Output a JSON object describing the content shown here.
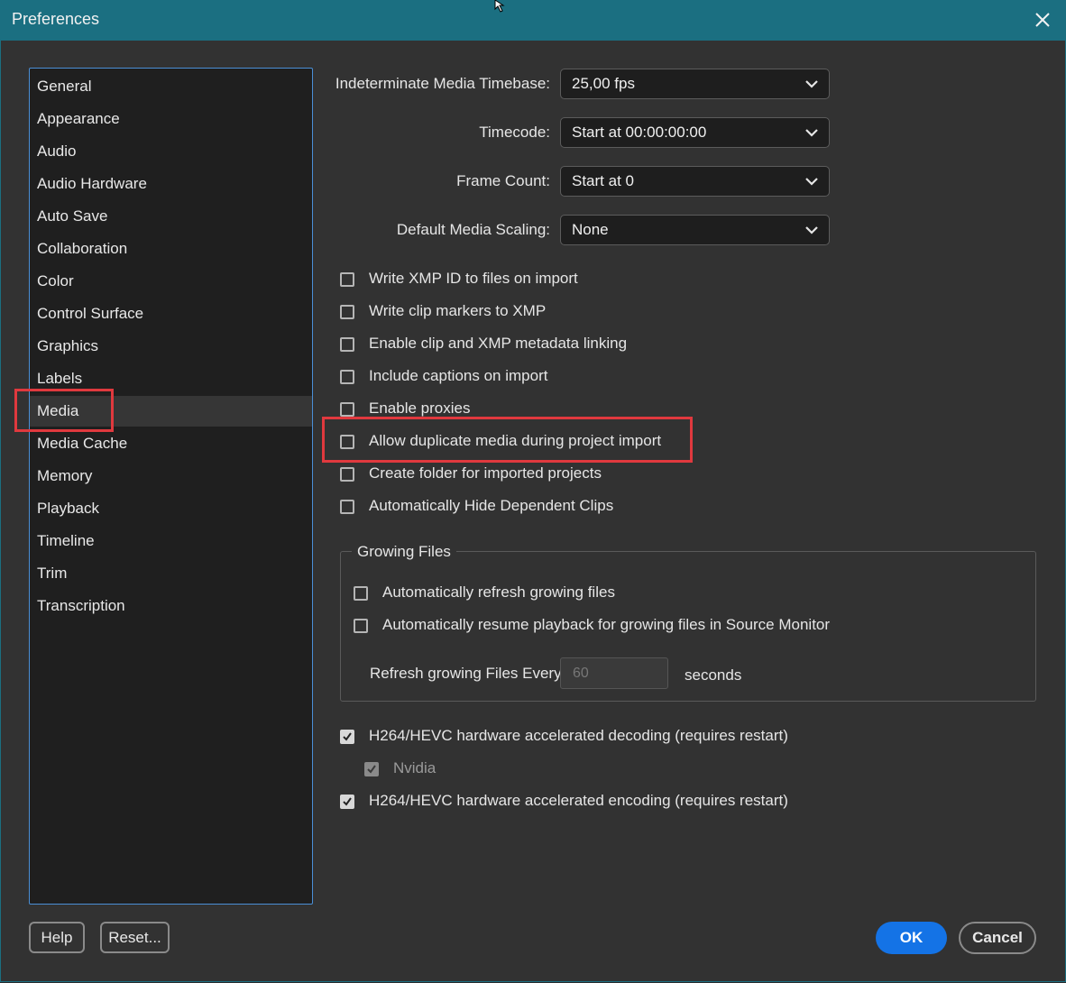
{
  "window": {
    "title": "Preferences",
    "titlebar_color": "#1b6f81"
  },
  "sidebar": {
    "items": [
      {
        "label": "General"
      },
      {
        "label": "Appearance"
      },
      {
        "label": "Audio"
      },
      {
        "label": "Audio Hardware"
      },
      {
        "label": "Auto Save"
      },
      {
        "label": "Collaboration"
      },
      {
        "label": "Color"
      },
      {
        "label": "Control Surface"
      },
      {
        "label": "Graphics"
      },
      {
        "label": "Labels"
      },
      {
        "label": "Media"
      },
      {
        "label": "Media Cache"
      },
      {
        "label": "Memory"
      },
      {
        "label": "Playback"
      },
      {
        "label": "Timeline"
      },
      {
        "label": "Trim"
      },
      {
        "label": "Transcription"
      }
    ],
    "selected": "Media"
  },
  "settings": {
    "timebase": {
      "label": "Indeterminate Media Timebase:",
      "value": "25,00 fps"
    },
    "timecode": {
      "label": "Timecode:",
      "value": "Start at 00:00:00:00"
    },
    "frame_count": {
      "label": "Frame Count:",
      "value": "Start at 0"
    },
    "scaling": {
      "label": "Default Media Scaling:",
      "value": "None"
    }
  },
  "checkboxes": [
    {
      "label": "Write XMP ID to files on import",
      "checked": false
    },
    {
      "label": "Write clip markers to XMP",
      "checked": false
    },
    {
      "label": "Enable clip and XMP metadata linking",
      "checked": false
    },
    {
      "label": "Include captions on import",
      "checked": false
    },
    {
      "label": "Enable proxies",
      "checked": false
    },
    {
      "label": "Allow duplicate media during project import",
      "checked": false
    },
    {
      "label": "Create folder for imported projects",
      "checked": false
    },
    {
      "label": "Automatically Hide Dependent Clips",
      "checked": false
    }
  ],
  "growing_files": {
    "title": "Growing Files",
    "refresh_label": "Automatically refresh growing files",
    "refresh_checked": false,
    "resume_label": "Automatically resume playback for growing files in Source Monitor",
    "resume_checked": false,
    "every_label": "Refresh growing Files Every",
    "every_value": "60",
    "unit": "seconds"
  },
  "hardware": {
    "decoding_label": "H264/HEVC hardware accelerated decoding (requires restart)",
    "decoding_checked": true,
    "nvidia_label": "Nvidia",
    "nvidia_checked": true,
    "encoding_label": "H264/HEVC hardware accelerated encoding (requires restart)",
    "encoding_checked": true
  },
  "buttons": {
    "help": "Help",
    "reset": "Reset...",
    "ok": "OK",
    "cancel": "Cancel"
  },
  "highlight_color": "#e0393e"
}
